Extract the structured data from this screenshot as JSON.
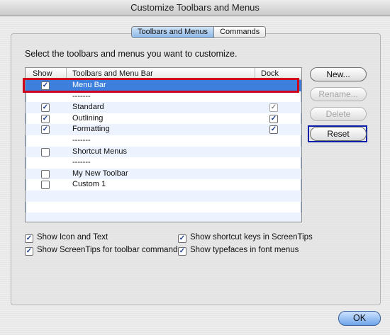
{
  "window": {
    "title": "Customize Toolbars and Menus"
  },
  "tabs": [
    {
      "label": "Toolbars and Menus",
      "active": true
    },
    {
      "label": "Commands",
      "active": false
    }
  ],
  "instruction": "Select the toolbars and menus you want to customize.",
  "list": {
    "columns": {
      "show": "Show",
      "name": "Toolbars and Menu Bar",
      "dock": "Dock"
    },
    "rows": [
      {
        "name": "Menu Bar",
        "show": true,
        "dock": null,
        "selected": true
      },
      {
        "name": "-------",
        "show": null,
        "dock": null
      },
      {
        "name": "Standard",
        "show": true,
        "dock": "dim"
      },
      {
        "name": "Outlining",
        "show": true,
        "dock": true
      },
      {
        "name": "Formatting",
        "show": true,
        "dock": true
      },
      {
        "name": "-------",
        "show": null,
        "dock": null
      },
      {
        "name": "Shortcut Menus",
        "show": false,
        "dock": null
      },
      {
        "name": "-------",
        "show": null,
        "dock": null
      },
      {
        "name": "My New Toolbar",
        "show": false,
        "dock": null
      },
      {
        "name": "Custom 1",
        "show": false,
        "dock": null
      }
    ]
  },
  "buttons": {
    "new": "New...",
    "rename": "Rename...",
    "delete": "Delete",
    "reset": "Reset",
    "ok": "OK"
  },
  "options": {
    "show_icon_text": "Show Icon and Text",
    "show_screentips": "Show ScreenTips for toolbar commands",
    "show_shortcut_keys": "Show shortcut keys in ScreenTips",
    "show_typefaces": "Show typefaces in font menus"
  },
  "checkmark": "✓",
  "colors": {
    "selection": "#3d7fdc",
    "highlight_red": "#d0011b",
    "highlight_blue": "#0b1eaa"
  }
}
